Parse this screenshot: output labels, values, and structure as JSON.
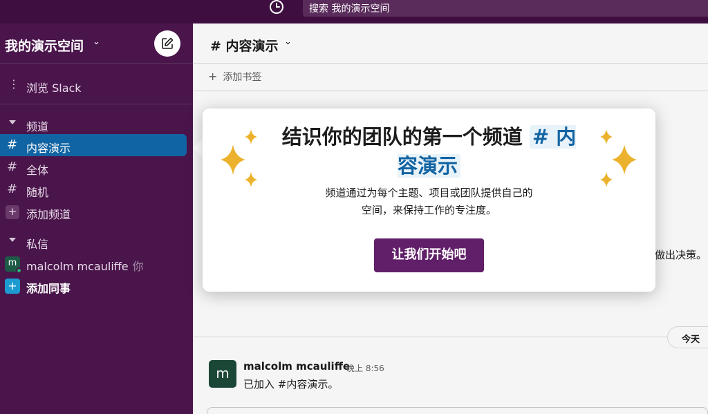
{
  "topbar": {
    "history_icon": "clock-icon",
    "search_label": "搜索 我的演示空间"
  },
  "sidebar": {
    "workspace_name": "我的演示空间",
    "workspace_chevron": "⌄",
    "compose_icon": "compose-icon",
    "browse_icon": "⋮",
    "browse_label": "浏览 Slack",
    "channels_header": "频道",
    "channels": [
      {
        "label": "内容演示",
        "icon": "#",
        "active": true
      },
      {
        "label": "全体",
        "icon": "#"
      },
      {
        "label": "随机",
        "icon": "#"
      }
    ],
    "add_channel_label": "添加频道",
    "add_channel_icon": "+",
    "dm_header": "私信",
    "dm_user": "malcolm mcauliffe",
    "dm_user_avatar": "m",
    "dm_you_tag": "你",
    "add_teammate_label": "添加同事",
    "add_teammate_icon": "+"
  },
  "main": {
    "channel_title": "# 内容演示",
    "channel_chevron": "⌄",
    "bookmark_icon": "+",
    "bookmark_label": "添加书签",
    "bg_text": "做出决策。",
    "day_divider": "今天",
    "day_chevron": "⌄",
    "message": {
      "avatar": "m",
      "author": "malcolm mcauliffe",
      "time": "晚上 8:56",
      "text": "已加入 #内容演示。"
    }
  },
  "popup": {
    "title_prefix": "结识你的团队的第一个频道",
    "title_channel": "# 内容演示",
    "desc_line1": "频道通过为每个主题、项目或团队提供自己的",
    "desc_line2": "空间，来保持工作的专注度。",
    "button_label": "让我们开始吧",
    "sparkle_color": "#ecb22e"
  },
  "colors": {
    "sidebar_bg": "#4a154b",
    "topbar_bg": "#3f0e40",
    "active_channel": "#1164a3",
    "primary_button": "#611f69"
  }
}
